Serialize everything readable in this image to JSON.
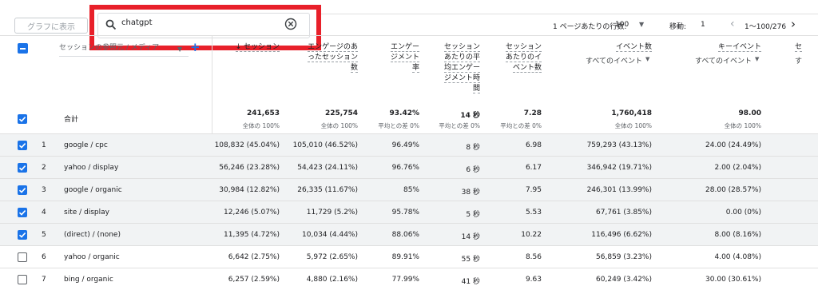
{
  "toolbar": {
    "graph_button": "グラフに表示",
    "search_value": "chatgpt",
    "rows_per_page_label": "1 ページあたりの行数:",
    "rows_per_page_value": "100",
    "goto_label": "移動:",
    "goto_value": "1",
    "range_text": "1〜100/276"
  },
  "table": {
    "dimension_select": "セッションの参照元 / メディア",
    "columns": [
      {
        "lines": [
          "↓ セッション"
        ],
        "sub": ""
      },
      {
        "lines": [
          "エンゲージのあ",
          "ったセッション",
          "数"
        ],
        "sub": ""
      },
      {
        "lines": [
          "エンゲー",
          "ジメント",
          "率"
        ],
        "sub": ""
      },
      {
        "lines": [
          "セッション",
          "あたりの平",
          "均エンゲー",
          "ジメント時",
          "間"
        ],
        "sub": ""
      },
      {
        "lines": [
          "セッション",
          "あたりのイ",
          "ベント数"
        ],
        "sub": ""
      },
      {
        "lines": [
          "イベント数"
        ],
        "sub": "すべてのイベント"
      },
      {
        "lines": [
          "キーイベント"
        ],
        "sub": "すべてのイベント"
      },
      {
        "lines": [
          "セ"
        ],
        "sub": "す"
      }
    ],
    "totals": {
      "label": "合計",
      "values": [
        "241,653",
        "225,754",
        "93.42%",
        "14 秒",
        "7.28",
        "1,760,418",
        "98.00"
      ],
      "subs": [
        "全体の 100%",
        "全体の 100%",
        "平均との差 0%",
        "平均との差 0%",
        "平均との差 0%",
        "全体の 100%",
        "全体の 100%"
      ]
    },
    "rows": [
      {
        "n": "1",
        "checked": true,
        "source": "google / cpc",
        "sessions": "108,832 (45.04%)",
        "engaged": "105,010 (46.52%)",
        "rate": "96.49%",
        "time": "8 秒",
        "eps": "6.98",
        "events": "759,293 (43.13%)",
        "key": "24.00 (24.49%)"
      },
      {
        "n": "2",
        "checked": true,
        "source": "yahoo / display",
        "sessions": "56,246 (23.28%)",
        "engaged": "54,423 (24.11%)",
        "rate": "96.76%",
        "time": "6 秒",
        "eps": "6.17",
        "events": "346,942 (19.71%)",
        "key": "2.00 (2.04%)"
      },
      {
        "n": "3",
        "checked": true,
        "source": "google / organic",
        "sessions": "30,984 (12.82%)",
        "engaged": "26,335 (11.67%)",
        "rate": "85%",
        "time": "38 秒",
        "eps": "7.95",
        "events": "246,301 (13.99%)",
        "key": "28.00 (28.57%)"
      },
      {
        "n": "4",
        "checked": true,
        "source": "site / display",
        "sessions": "12,246 (5.07%)",
        "engaged": "11,729 (5.2%)",
        "rate": "95.78%",
        "time": "5 秒",
        "eps": "5.53",
        "events": "67,761 (3.85%)",
        "key": "0.00 (0%)"
      },
      {
        "n": "5",
        "checked": true,
        "source": "(direct) / (none)",
        "sessions": "11,395 (4.72%)",
        "engaged": "10,034 (4.44%)",
        "rate": "88.06%",
        "time": "14 秒",
        "eps": "10.22",
        "events": "116,496 (6.62%)",
        "key": "8.00 (8.16%)"
      },
      {
        "n": "6",
        "checked": false,
        "source": "yahoo / organic",
        "sessions": "6,642 (2.75%)",
        "engaged": "5,972 (2.65%)",
        "rate": "89.91%",
        "time": "55 秒",
        "eps": "8.56",
        "events": "56,859 (3.23%)",
        "key": "4.00 (4.08%)"
      },
      {
        "n": "7",
        "checked": false,
        "source": "bing / organic",
        "sessions": "6,257 (2.59%)",
        "engaged": "4,880 (2.16%)",
        "rate": "77.99%",
        "time": "41 秒",
        "eps": "9.63",
        "events": "60,249 (3.42%)",
        "key": "30.00 (30.61%)"
      }
    ]
  },
  "colors": {
    "accent": "#1a73e8",
    "highlight": "#e8202a"
  }
}
